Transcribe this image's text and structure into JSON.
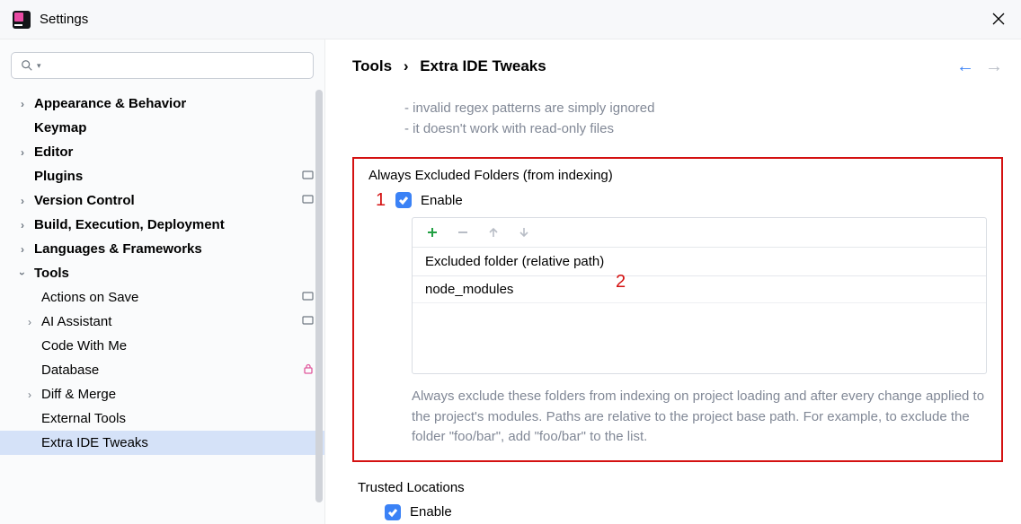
{
  "titlebar": {
    "title": "Settings"
  },
  "search": {
    "placeholder": ""
  },
  "sidebar": {
    "items": [
      {
        "label": "Appearance & Behavior",
        "expandable": true,
        "expanded": false
      },
      {
        "label": "Keymap",
        "expandable": false
      },
      {
        "label": "Editor",
        "expandable": true,
        "expanded": false
      },
      {
        "label": "Plugins",
        "expandable": false,
        "tag": true
      },
      {
        "label": "Version Control",
        "expandable": true,
        "expanded": false,
        "tag": true
      },
      {
        "label": "Build, Execution, Deployment",
        "expandable": true,
        "expanded": false
      },
      {
        "label": "Languages & Frameworks",
        "expandable": true,
        "expanded": false
      },
      {
        "label": "Tools",
        "expandable": true,
        "expanded": true,
        "children": [
          {
            "label": "Actions on Save",
            "tag": true
          },
          {
            "label": "AI Assistant",
            "expandable": true,
            "tag": true
          },
          {
            "label": "Code With Me"
          },
          {
            "label": "Database",
            "lock": true
          },
          {
            "label": "Diff & Merge",
            "expandable": true
          },
          {
            "label": "External Tools"
          },
          {
            "label": "Extra IDE Tweaks",
            "selected": true
          }
        ]
      }
    ]
  },
  "breadcrumb": {
    "root": "Tools",
    "leaf": "Extra IDE Tweaks"
  },
  "hints": {
    "line1": "- invalid regex patterns are simply ignored",
    "line2": "- it doesn't work with read-only files"
  },
  "excluded": {
    "title": "Always Excluded Folders (from indexing)",
    "enable_label": "Enable",
    "column_header": "Excluded folder (relative path)",
    "rows": [
      "node_modules"
    ],
    "help": "Always exclude these folders from indexing on project loading and after every change applied to the project's modules. Paths are relative to the project base path. For example, to exclude the folder \"foo/bar\", add \"foo/bar\" to the list."
  },
  "trusted": {
    "title": "Trusted Locations",
    "enable_label": "Enable"
  },
  "annotations": {
    "one": "1",
    "two": "2"
  }
}
